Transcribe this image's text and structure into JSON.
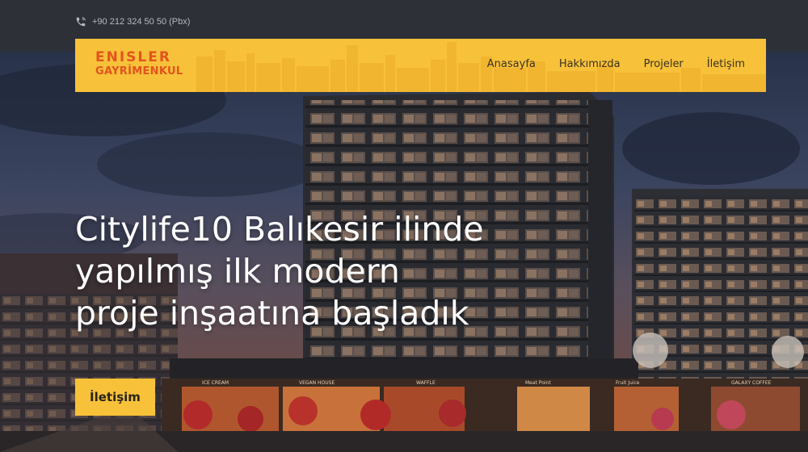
{
  "topbar": {
    "phone": "+90 212 324 50 50 (Pbx)"
  },
  "brand": {
    "line1": "ENISLER",
    "line2": "GAYRİMENKUL"
  },
  "nav": {
    "items": [
      {
        "label": "Anasayfa"
      },
      {
        "label": "Hakkımızda"
      },
      {
        "label": "Projeler"
      },
      {
        "label": "İletişim"
      }
    ]
  },
  "hero": {
    "lines": [
      "Citylife10 Balıkesir ilinde",
      "yapılmış ilk modern",
      "proje inşaatına başladık"
    ],
    "cta_label": "İletişim",
    "shop_signs": [
      "ICE CREAM",
      "VEGAN HOUSE",
      "WAFFLE",
      "Meat Point",
      "Fruit Juice",
      "GALAXY COFFEE"
    ]
  },
  "colors": {
    "accent": "#f7c139",
    "brand_text": "#e2541f",
    "topbar": "#2d3037"
  }
}
